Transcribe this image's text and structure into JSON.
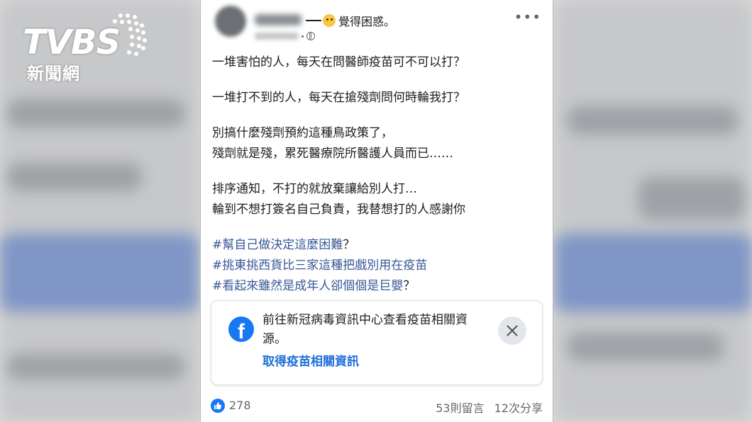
{
  "watermark": {
    "brand": "TVBS",
    "subtitle": "新聞網"
  },
  "post": {
    "feeling": "覺得困惑。",
    "more_label": "•••",
    "lines": [
      "一堆害怕的人，每天在問醫師疫苗可不可以打？",
      "一堆打不到的人，每天在搶殘劑問何時輪我打？",
      "別搞什麼殘劑預約這種鳥政策了，",
      "殘劑就是殘，累死醫療院所醫護人員而已……",
      "排序通知，不打的就放棄讓給別人打…",
      "輪到不想打簽名自己負責，我替想打的人感謝你"
    ],
    "hashtags": [
      {
        "tag": "#幫自己做決定這麼困難",
        "suffix": "？"
      },
      {
        "tag": "#挑東挑西貨比三家這種把戲別用在疫苗",
        "suffix": ""
      },
      {
        "tag": "#看起來雖然是成年人卻個個是巨嬰",
        "suffix": "？"
      }
    ]
  },
  "info_box": {
    "text": "前往新冠病毒資訊中心查看疫苗相關資源。",
    "link": "取得疫苗相關資訊"
  },
  "footer": {
    "reactions": "278",
    "comments": "53則留言",
    "shares": "12次分享"
  },
  "colors": {
    "hashtag": "#385898",
    "facebook_blue": "#1877f2",
    "link": "#216fdb"
  }
}
